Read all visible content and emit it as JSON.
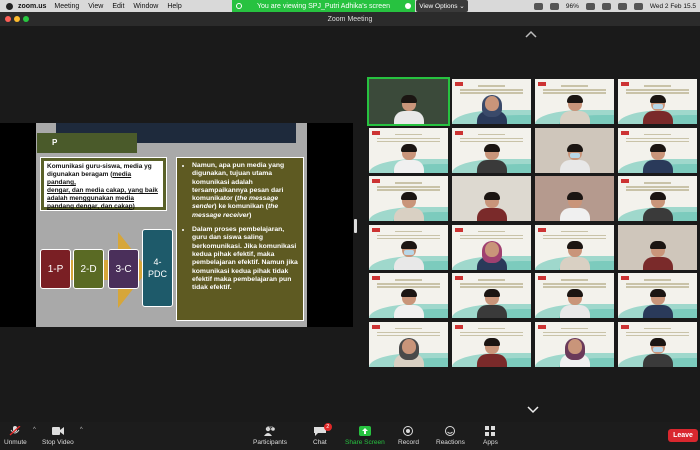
{
  "menubar": {
    "app_name": "zoom.us",
    "items": [
      "Meeting",
      "View",
      "Edit",
      "Window",
      "Help"
    ],
    "tray": {
      "battery": "96%",
      "datetime": "Wed 2 Feb  15.5"
    }
  },
  "share_banner": {
    "text": "You are viewing SPJ_Putri Adhika's screen",
    "view_options_label": "View Options ⌄"
  },
  "window": {
    "title": "Zoom Meeting"
  },
  "slide": {
    "title_fragment": "P",
    "quote_lines": [
      "Komunikasi guru-siswa, media yg",
      "digunakan beragam (",
      "media pandang,",
      "dengar, dan media cakap, yang baik",
      "adalah menggunakan media",
      "pandang dengar, dan cakap",
      ")"
    ],
    "steps": [
      "1-P",
      "2-D",
      "3-C",
      "4-",
      "PDC"
    ],
    "bullets": [
      {
        "parts": [
          "Namun, apa pun media yang digunakan, tujuan utama komunikasi adalah tersampaikannya pesan dari komunikator (",
          "the message sender",
          ") ke komunikan (",
          "the message receiver",
          ")"
        ]
      },
      {
        "parts": [
          "Dalam proses pembelajaran, guru dan siswa saling berkomunikasi. Jika komunikasi kedua pihak efektif, maka pembelajaran efektif. Namun jika komunikasi kedua pihak tidak efektif maka pembelajaran pun tidak efektif."
        ]
      }
    ]
  },
  "toolbar": {
    "unmute": "Unmute",
    "stop_video": "Stop Video",
    "participants": "Participants",
    "participants_count": "69",
    "chat": "Chat",
    "chat_badge": "2",
    "share_screen": "Share Screen",
    "record": "Record",
    "reactions": "Reactions",
    "apps": "Apps",
    "leave": "Leave"
  },
  "colors": {
    "zoom_green": "#27c240",
    "leave_red": "#d9272e",
    "badge_red": "#e02828"
  }
}
